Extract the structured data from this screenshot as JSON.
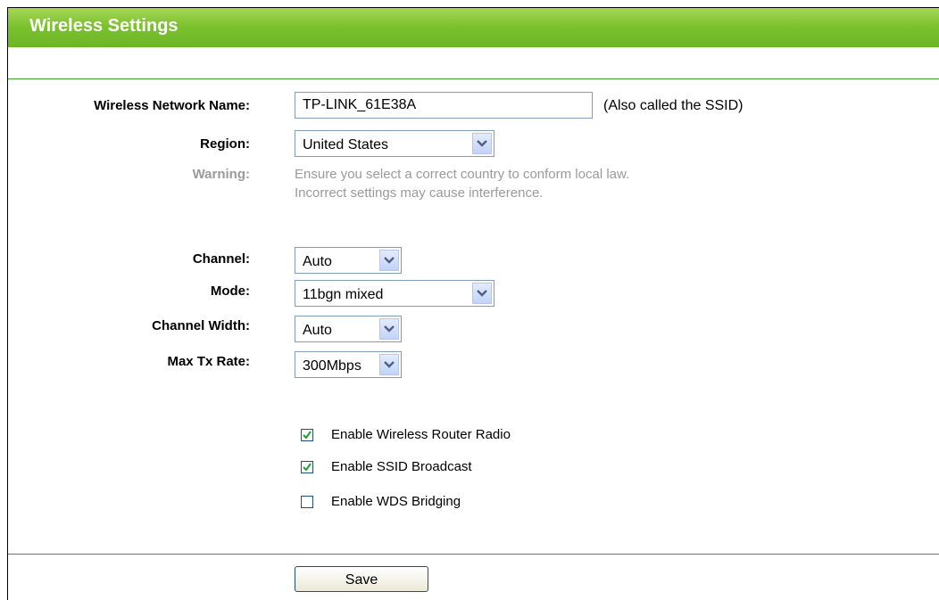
{
  "page": {
    "title": "Wireless Settings"
  },
  "form": {
    "ssid": {
      "label": "Wireless Network Name:",
      "value": "TP-LINK_61E38A",
      "hint": "(Also called the SSID)"
    },
    "region": {
      "label": "Region:",
      "value": "United States"
    },
    "warning": {
      "label": "Warning:",
      "line1": "Ensure you select a correct country to conform local law.",
      "line2": "Incorrect settings may cause interference."
    },
    "channel": {
      "label": "Channel:",
      "value": "Auto"
    },
    "mode": {
      "label": "Mode:",
      "value": "11bgn mixed"
    },
    "channel_width": {
      "label": "Channel Width:",
      "value": "Auto"
    },
    "max_tx_rate": {
      "label": "Max Tx Rate:",
      "value": "300Mbps"
    },
    "checkboxes": [
      {
        "label": "Enable Wireless Router Radio",
        "checked": true
      },
      {
        "label": "Enable SSID Broadcast",
        "checked": true
      },
      {
        "label": "Enable WDS Bridging",
        "checked": false
      }
    ],
    "save_label": "Save"
  },
  "colors": {
    "title_green": "#6cb626",
    "rule_green": "#3f9d2c",
    "warning_grey": "#9a9a9a"
  },
  "icons": {
    "dropdown": "chevron-down-icon",
    "check": "checkmark-icon"
  }
}
